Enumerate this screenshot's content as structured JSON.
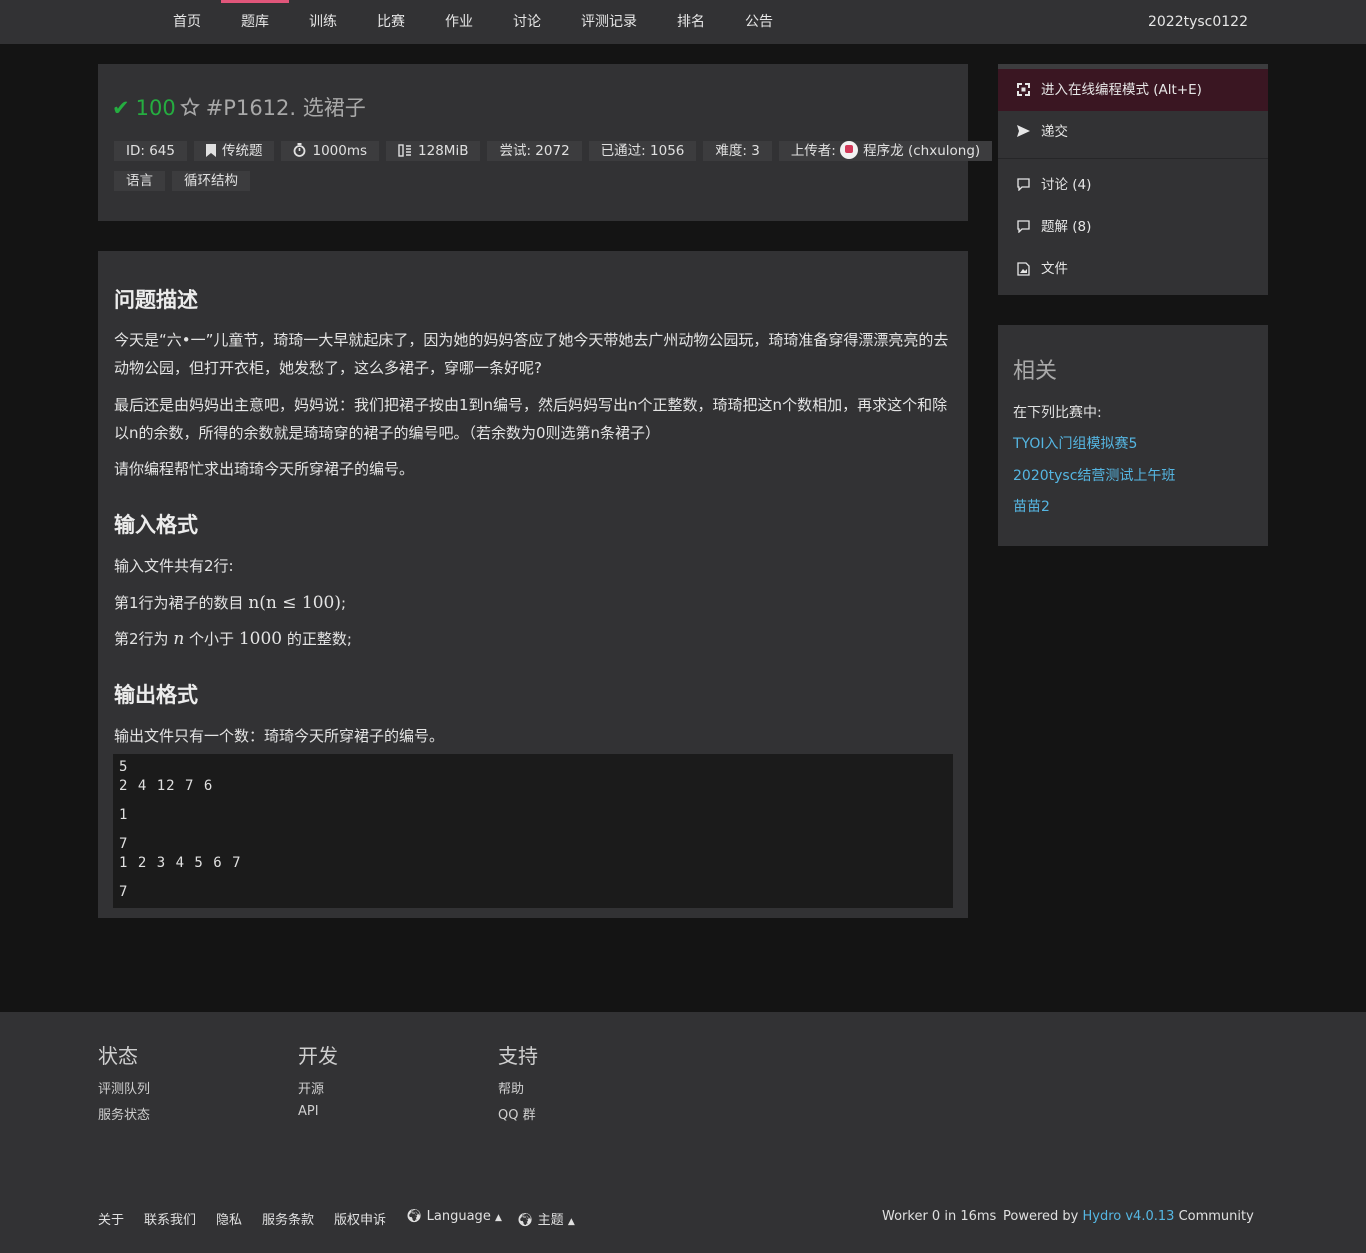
{
  "nav": {
    "items": [
      "首页",
      "题库",
      "训练",
      "比赛",
      "作业",
      "讨论",
      "评测记录",
      "排名",
      "公告"
    ],
    "active": "题库",
    "user": "2022tysc0122"
  },
  "problem": {
    "score": "100",
    "title": "#P1612. 选裙子",
    "meta": {
      "id": "ID: 645",
      "type": "传统题",
      "time": "1000ms",
      "memory": "128MiB",
      "tried": "尝试: 2072",
      "accepted": "已通过: 1056",
      "difficulty": "难度: 3",
      "uploader_label": "上传者:",
      "uploader": "程序龙 (chxulong)"
    },
    "tags": [
      "语言",
      "循环结构"
    ]
  },
  "content": {
    "h_desc": "问题描述",
    "desc_1": "今天是“六•一”儿童节，琦琦一大早就起床了，因为她的妈妈答应了她今天带她去广州动物公园玩，琦琦准备穿得漂漂亮亮的去动物公园，但打开衣柜，她发愁了，这么多裙子，穿哪一条好呢?",
    "desc_2": "最后还是由妈妈出主意吧，妈妈说：我们把裙子按由1到n编号，然后妈妈写出n个正整数，琦琦把这n个数相加，再求这个和除以n的余数，所得的余数就是琦琦穿的裙子的编号吧。（若余数为0则选第n条裙子）",
    "desc_3": "请你编程帮忙求出琦琦今天所穿裙子的编号。",
    "h_input": "输入格式",
    "input_1": "输入文件共有2行:",
    "input_2_pre": "第1行为裙子的数目 ",
    "input_2_math": "n(n ≤ 100)",
    "input_2_post": ";",
    "input_3_pre": "第2行为 ",
    "input_3_n": "n",
    "input_3_mid": " 个小于 ",
    "input_3_num": "1000",
    "input_3_post": " 的正整数;",
    "h_output": "输出格式",
    "output_1": "输出文件只有一个数：琦琦今天所穿裙子的编号。",
    "code": [
      "5",
      "2 4 12 7 6",
      "1",
      "7",
      "1 2 3 4 5 6 7",
      "7"
    ]
  },
  "sidebar": {
    "ide": "进入在线编程模式 (Alt+E)",
    "submit": "递交",
    "discuss": "讨论 (4)",
    "solution": "题解 (8)",
    "files": "文件"
  },
  "related": {
    "title": "相关",
    "in_contests": "在下列比赛中:",
    "contests": [
      "TYOI入门组模拟赛5",
      "2020tysc结营测试上午班",
      "苗苗2"
    ]
  },
  "footer": {
    "cols": [
      {
        "title": "状态",
        "links": [
          "评测队列",
          "服务状态"
        ]
      },
      {
        "title": "开发",
        "links": [
          "开源",
          "API"
        ]
      },
      {
        "title": "支持",
        "links": [
          "帮助",
          "QQ 群"
        ]
      }
    ],
    "bottom_links": [
      "关于",
      "联系我们",
      "隐私",
      "服务条款",
      "版权申诉"
    ],
    "language": "Language",
    "theme": "主题",
    "worker": "Worker 0 in 16ms",
    "powered_pre": "Powered by",
    "powered_link": "Hydro v4.0.13",
    "powered_post": "Community"
  },
  "colors": {
    "accent": "#e0567a",
    "success": "#25ad40",
    "link": "#55b6e2",
    "panel": "#323234",
    "background": "#141414"
  }
}
